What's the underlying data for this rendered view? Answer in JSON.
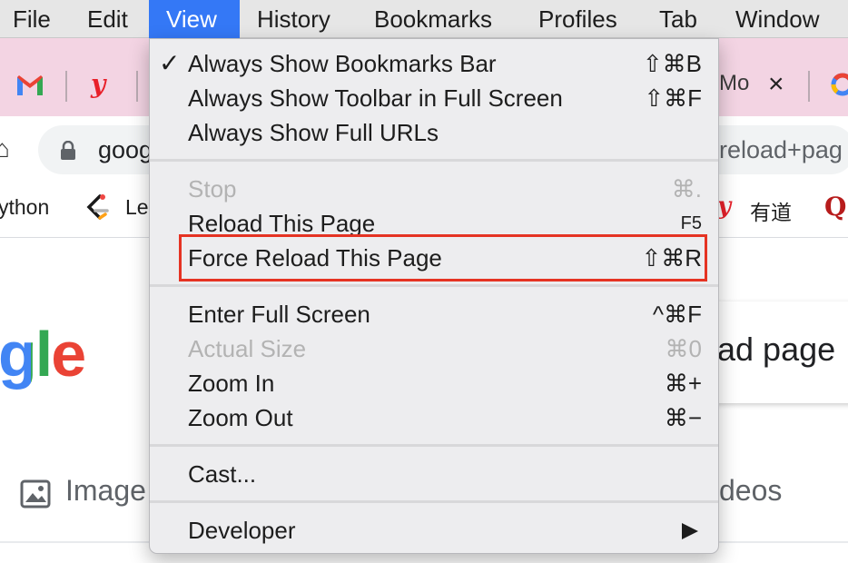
{
  "menubar": {
    "items": [
      "File",
      "Edit",
      "View",
      "History",
      "Bookmarks",
      "Profiles",
      "Tab",
      "Window"
    ],
    "active": "View"
  },
  "tabs": {
    "partial_title": "Mo",
    "close_glyph": "×"
  },
  "address": {
    "url_start": "goog",
    "url_end": "reload+pag"
  },
  "bookmarks": {
    "items": [
      "ython",
      "Le",
      "有道"
    ]
  },
  "page": {
    "logo_text": "gle",
    "search_text": "ad page",
    "nav_left": "Image",
    "nav_right": "deos"
  },
  "view_menu": {
    "groups": [
      [
        {
          "label": "Always Show Bookmarks Bar",
          "shortcut": "⇧⌘B",
          "checked": true
        },
        {
          "label": "Always Show Toolbar in Full Screen",
          "shortcut": "⇧⌘F"
        },
        {
          "label": "Always Show Full URLs",
          "shortcut": ""
        }
      ],
      [
        {
          "label": "Stop",
          "shortcut": "⌘.",
          "disabled": true
        },
        {
          "label": "Reload This Page",
          "shortcut": "F5"
        },
        {
          "label": "Force Reload This Page",
          "shortcut": "⇧⌘R",
          "highlighted": true
        }
      ],
      [
        {
          "label": "Enter Full Screen",
          "shortcut": "^⌘F"
        },
        {
          "label": "Actual Size",
          "shortcut": "⌘0",
          "disabled": true
        },
        {
          "label": "Zoom In",
          "shortcut": "⌘+"
        },
        {
          "label": "Zoom Out",
          "shortcut": "⌘−"
        }
      ],
      [
        {
          "label": "Cast...",
          "shortcut": ""
        }
      ],
      [
        {
          "label": "Developer",
          "submenu": true
        }
      ]
    ],
    "check_glyph": "✓"
  },
  "colors": {
    "menu_active_bg": "#3478f6",
    "highlight_box": "#e53323",
    "tab_strip_bg": "#f3d4e3",
    "menu_bg": "#ededef"
  }
}
